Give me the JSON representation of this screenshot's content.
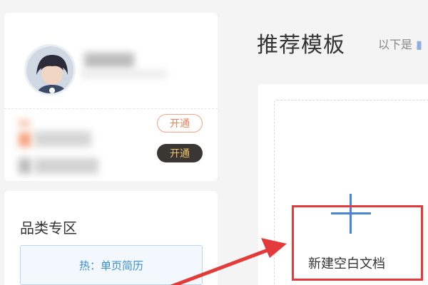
{
  "profile": {
    "vip_rows": [
      {
        "button_label": "开通",
        "style": "outline"
      },
      {
        "button_label": "开通",
        "style": "dark"
      }
    ]
  },
  "category": {
    "title": "品类专区",
    "hot_item": "热：单页简历"
  },
  "templates": {
    "title": "推荐模板",
    "subtitle": "以下是 ",
    "new_blank_label": "新建空白文档"
  },
  "icons": {
    "plus": "plus-icon",
    "arrow": "red-arrow-annotation"
  },
  "colors": {
    "accent_blue": "#4a84d4",
    "annotation_red": "#e53a3a",
    "outline_orange": "#e8805a",
    "dark_button": "#3a3633",
    "gold_text": "#f3c56b"
  }
}
